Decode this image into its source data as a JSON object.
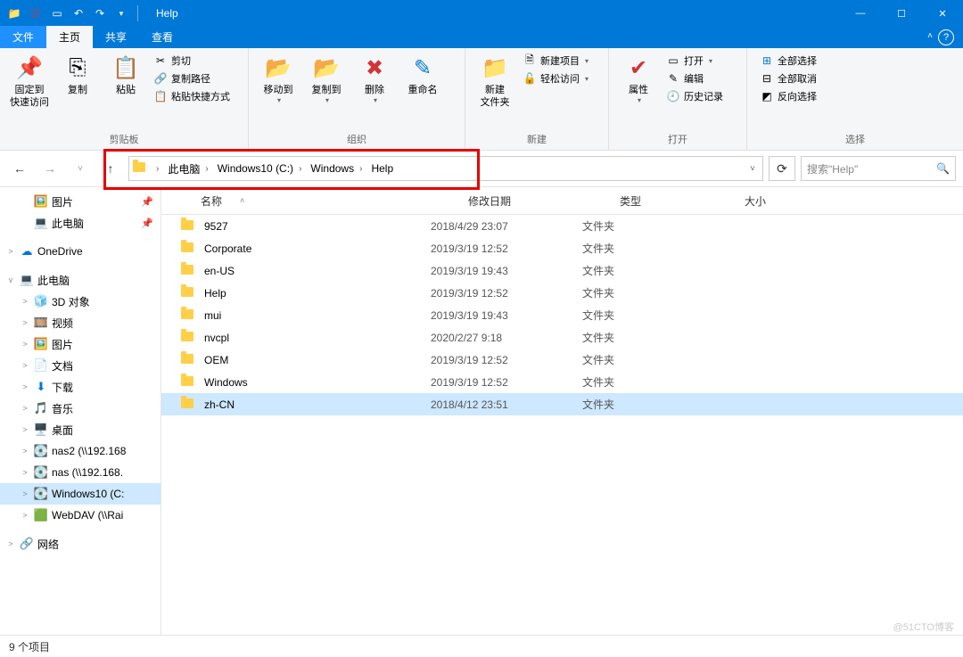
{
  "title": "Help",
  "qat": [
    "folder-icon",
    "check-icon",
    "props-icon",
    "undo-icon",
    "redo-icon"
  ],
  "winbtns": {
    "min": "—",
    "max": "☐",
    "close": "✕"
  },
  "tabs": {
    "file": "文件",
    "home": "主页",
    "share": "共享",
    "view": "查看"
  },
  "ribbon": {
    "clipboard": {
      "label": "剪贴板",
      "pin": "固定到\n快速访问",
      "copy": "复制",
      "paste": "粘贴",
      "cut": "剪切",
      "copypath": "复制路径",
      "pasteshort": "粘贴快捷方式"
    },
    "organize": {
      "label": "组织",
      "moveto": "移动到",
      "copyto": "复制到",
      "delete": "删除",
      "rename": "重命名"
    },
    "new": {
      "label": "新建",
      "newfolder": "新建\n文件夹",
      "newitem": "新建项目",
      "easyaccess": "轻松访问"
    },
    "open": {
      "label": "打开",
      "properties": "属性",
      "open": "打开",
      "edit": "编辑",
      "history": "历史记录"
    },
    "select": {
      "label": "选择",
      "selectall": "全部选择",
      "selectnone": "全部取消",
      "invert": "反向选择"
    }
  },
  "breadcrumb": [
    "此电脑",
    "Windows10 (C:)",
    "Windows",
    "Help"
  ],
  "search_placeholder": "搜索\"Help\"",
  "columns": {
    "name": "名称",
    "date": "修改日期",
    "type": "类型",
    "size": "大小"
  },
  "sidebar": [
    {
      "indent": 1,
      "icon": "🖼️",
      "label": "图片",
      "pin": true,
      "color": "c-blue"
    },
    {
      "indent": 1,
      "icon": "💻",
      "label": "此电脑",
      "pin": true,
      "color": "c-blue"
    },
    {
      "spacer": true
    },
    {
      "indent": 0,
      "exp": ">",
      "icon": "☁",
      "label": "OneDrive",
      "color": "c-blue"
    },
    {
      "spacer": true
    },
    {
      "indent": 0,
      "exp": "v",
      "icon": "💻",
      "label": "此电脑",
      "color": "c-blue"
    },
    {
      "indent": 1,
      "exp": ">",
      "icon": "🧊",
      "label": "3D 对象",
      "color": "c-blue"
    },
    {
      "indent": 1,
      "exp": ">",
      "icon": "🎞️",
      "label": "视频",
      "color": ""
    },
    {
      "indent": 1,
      "exp": ">",
      "icon": "🖼️",
      "label": "图片",
      "color": "c-blue"
    },
    {
      "indent": 1,
      "exp": ">",
      "icon": "📄",
      "label": "文档",
      "color": "c-gray"
    },
    {
      "indent": 1,
      "exp": ">",
      "icon": "⬇",
      "label": "下载",
      "color": "c-blue"
    },
    {
      "indent": 1,
      "exp": ">",
      "icon": "🎵",
      "label": "音乐",
      "color": "c-blue"
    },
    {
      "indent": 1,
      "exp": ">",
      "icon": "🖥️",
      "label": "桌面",
      "color": "c-blue"
    },
    {
      "indent": 1,
      "exp": ">",
      "icon": "💽",
      "label": "nas2 (\\\\192.168",
      "color": ""
    },
    {
      "indent": 1,
      "exp": ">",
      "icon": "💽",
      "label": "nas (\\\\192.168.",
      "color": ""
    },
    {
      "indent": 1,
      "exp": ">",
      "icon": "💽",
      "label": "Windows10 (C:",
      "selected": true,
      "color": ""
    },
    {
      "indent": 1,
      "exp": ">",
      "icon": "🟩",
      "label": "WebDAV (\\\\Rai",
      "color": "c-grn"
    },
    {
      "spacer": true
    },
    {
      "indent": 0,
      "exp": ">",
      "icon": "🔗",
      "label": "网络",
      "color": "c-blue"
    }
  ],
  "files": [
    {
      "name": "9527",
      "date": "2018/4/29 23:07",
      "type": "文件夹"
    },
    {
      "name": "Corporate",
      "date": "2019/3/19 12:52",
      "type": "文件夹"
    },
    {
      "name": "en-US",
      "date": "2019/3/19 19:43",
      "type": "文件夹"
    },
    {
      "name": "Help",
      "date": "2019/3/19 12:52",
      "type": "文件夹"
    },
    {
      "name": "mui",
      "date": "2019/3/19 19:43",
      "type": "文件夹"
    },
    {
      "name": "nvcpl",
      "date": "2020/2/27 9:18",
      "type": "文件夹"
    },
    {
      "name": "OEM",
      "date": "2019/3/19 12:52",
      "type": "文件夹"
    },
    {
      "name": "Windows",
      "date": "2019/3/19 12:52",
      "type": "文件夹"
    },
    {
      "name": "zh-CN",
      "date": "2018/4/12 23:51",
      "type": "文件夹",
      "selected": true
    }
  ],
  "status": "9 个项目",
  "watermark": "@51CTO博客"
}
